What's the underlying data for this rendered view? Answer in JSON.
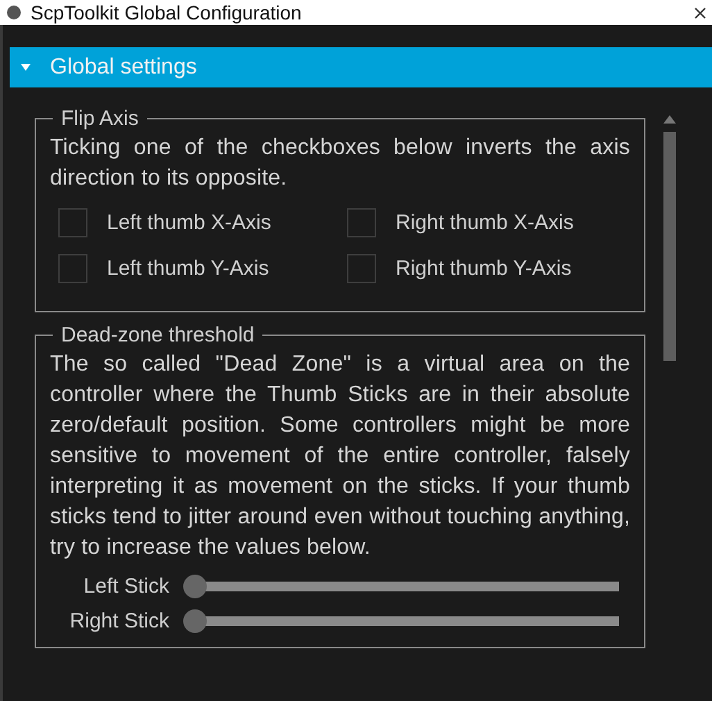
{
  "window": {
    "title": "ScpToolkit Global Configuration"
  },
  "section": {
    "title": "Global settings",
    "expanded": true
  },
  "flip_axis": {
    "title": "Flip Axis",
    "description": "Ticking one of the checkboxes below inverts the axis direction to its opposite.",
    "checkboxes": [
      {
        "label": "Left thumb X-Axis",
        "checked": false
      },
      {
        "label": "Right thumb X-Axis",
        "checked": false
      },
      {
        "label": "Left thumb Y-Axis",
        "checked": false
      },
      {
        "label": "Right thumb Y-Axis",
        "checked": false
      }
    ]
  },
  "dead_zone": {
    "title": "Dead-zone threshold",
    "description": "The so called \"Dead Zone\" is a virtual area on the controller where the Thumb Sticks are in their absolute zero/default position. Some controllers might be more sensitive to movement of the entire controller, falsely interpreting it as movement on the sticks. If your thumb sticks tend to jitter around even without touching anything, try to increase the values below.",
    "sliders": [
      {
        "label": "Left Stick",
        "level": 0
      },
      {
        "label": "Right Stick",
        "level": 0
      }
    ]
  }
}
